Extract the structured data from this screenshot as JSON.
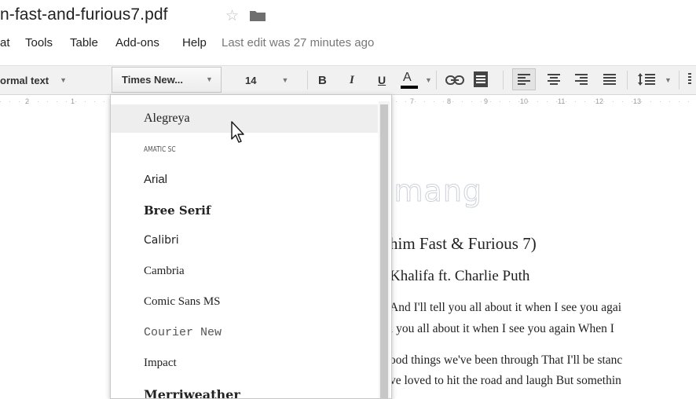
{
  "window": {
    "doc_title": "n-fast-and-furious7.pdf",
    "star_icon": "star-icon",
    "folder_icon": "folder-icon"
  },
  "menu": {
    "items": [
      "at",
      "Tools",
      "Table",
      "Add-ons",
      "Help"
    ],
    "last_edit": "Last edit was 27 minutes ago"
  },
  "toolbar": {
    "style_label": "ormal text",
    "font_label": "Times New...",
    "size_label": "14",
    "bold": "B",
    "italic": "I",
    "underline": "U",
    "text_color": "A",
    "link_icon": "link-icon",
    "comment_icon": "comment-icon",
    "align_left_icon": "align-left-icon",
    "align_center_icon": "align-center-icon",
    "align_right_icon": "align-right-icon",
    "align_justify_icon": "align-justify-icon",
    "line_spacing_icon": "line-spacing-icon"
  },
  "ruler": {
    "ticks": [
      "2",
      "1",
      "7",
      "8",
      "9",
      "10",
      "11",
      "12",
      "13"
    ]
  },
  "font_menu": {
    "items": [
      "Alegreya",
      "Amatic SC",
      "Arial",
      "Bree Serif",
      "Calibri",
      "Cambria",
      "Comic Sans MS",
      "Courier New",
      "Impact",
      "Merriweather"
    ],
    "highlighted": "Alegreya"
  },
  "document": {
    "watermark": "uantrimang",
    "lines": [
      "him Fast & Furious 7)",
      "Khalifa ft. Charlie Puth",
      "And I'll tell you all about it when I see you agai",
      "l you all about it when I see you again When I",
      "ood things we've been through That I'll be stanc",
      "ve loved to hit the road and laugh But somethin"
    ]
  },
  "colors": {
    "toolbar_bg": "#f1f1f1",
    "text_color_bar": "#000000",
    "menu_hover": "#eeeeee"
  }
}
